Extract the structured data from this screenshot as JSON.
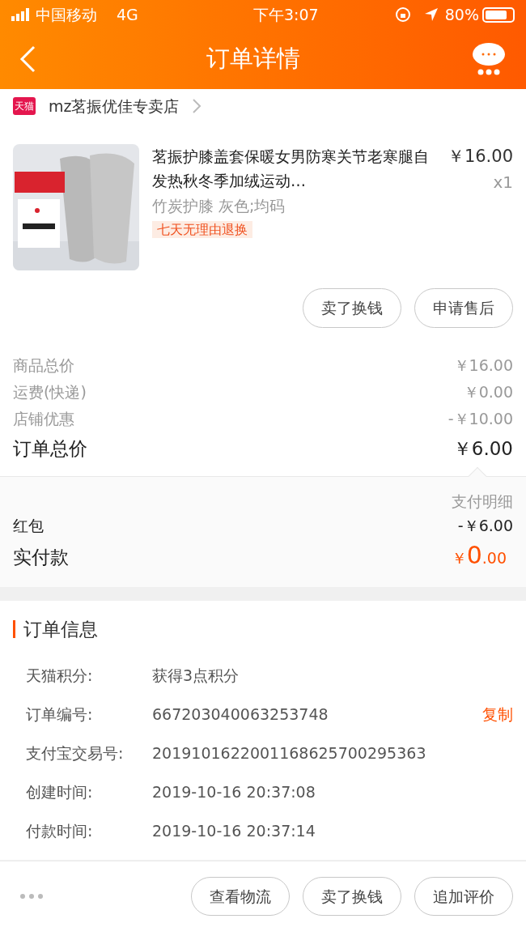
{
  "status_bar": {
    "carrier": "中国移动",
    "network": "4G",
    "time": "下午3:07",
    "battery_text": "80%"
  },
  "header": {
    "title": "订单详情"
  },
  "shop": {
    "badge": "天猫",
    "name": "mz茗振优佳专卖店"
  },
  "product": {
    "kind": "picture",
    "title": "茗振护膝盖套保暖女男防寒关节老寒腿自发热秋冬季加绒运动…",
    "price": "￥16.00",
    "quantity": "x1",
    "sku": "竹炭护膝 灰色;均码",
    "tag": "七天无理由退换"
  },
  "item_buttons": [
    "卖了换钱",
    "申请售后"
  ],
  "summary": [
    {
      "label": "商品总价",
      "value": "￥16.00",
      "kind": "minor"
    },
    {
      "label": "运费(快递)",
      "value": "￥0.00",
      "kind": "minor"
    },
    {
      "label": "店铺优惠",
      "value": "-￥10.00",
      "kind": "minor"
    },
    {
      "label": "订单总价",
      "value": "￥6.00",
      "kind": "total"
    }
  ],
  "payment": {
    "title": "支付明细",
    "rows": [
      {
        "label": "红包",
        "value": "-￥6.00"
      }
    ],
    "paid_label": "实付款",
    "paid": {
      "symbol": "￥",
      "integer": "0",
      "decimal": ".00"
    }
  },
  "order_info": {
    "title": "订单信息",
    "rows": [
      {
        "label": "天猫积分:",
        "value": "获得3点积分"
      },
      {
        "label": "订单编号:",
        "value": "667203040063253748",
        "action": "复制"
      },
      {
        "label": "支付宝交易号:",
        "value": "2019101622001168625700295363"
      },
      {
        "label": "创建时间:",
        "value": "2019-10-16 20:37:08"
      },
      {
        "label": "付款时间:",
        "value": "2019-10-16 20:37:14"
      }
    ]
  },
  "bottom_buttons": [
    "查看物流",
    "卖了换钱",
    "追加评价"
  ]
}
